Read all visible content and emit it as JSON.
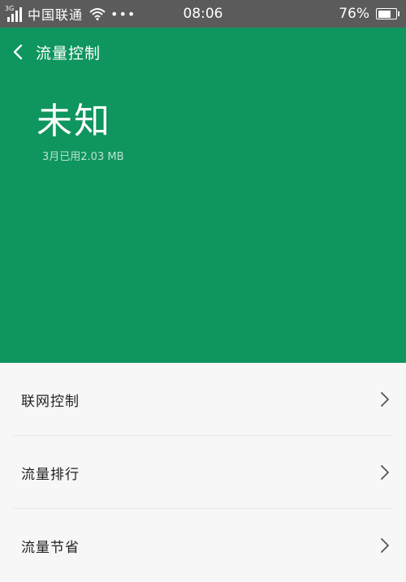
{
  "status_bar": {
    "signal_tag": "3G",
    "carrier": "中国联通",
    "more": "•••",
    "time": "08:06",
    "battery_percent_text": "76%",
    "battery_level": 0.76
  },
  "header": {
    "title": "流量控制",
    "status": "未知",
    "usage": "3月已用2.03 MB"
  },
  "menu": [
    {
      "label": "联网控制"
    },
    {
      "label": "流量排行"
    },
    {
      "label": "流量节省"
    }
  ],
  "colors": {
    "header_green": "#0f955e",
    "status_bar": "#5b5b5b",
    "list_bg": "#f7f7f7",
    "chevron": "#555555"
  },
  "icons": {
    "back": "back-chevron-icon",
    "row_arrow": "chevron-right-icon",
    "wifi": "wifi-icon",
    "signal": "signal-bars-icon",
    "battery": "battery-icon"
  }
}
